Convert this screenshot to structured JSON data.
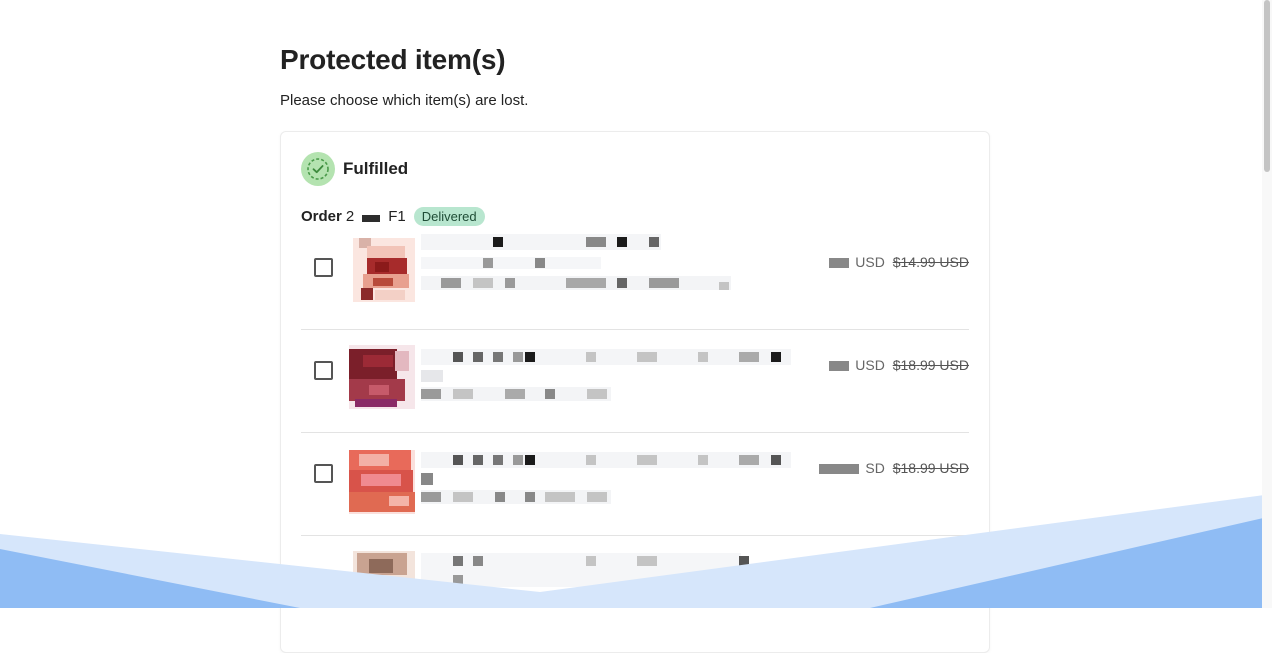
{
  "header": {
    "title": "Protected item(s)",
    "subtitle": "Please choose which item(s) are lost."
  },
  "fulfillment": {
    "status_label": "Fulfilled",
    "status_icon": "check-circle-icon",
    "order_label": "Order",
    "order_number_prefix": "2",
    "order_number_suffix": "F1",
    "badge": "Delivered"
  },
  "items": [
    {
      "currency": "USD",
      "compare_at_price": "$14.99 USD"
    },
    {
      "currency": "USD",
      "compare_at_price": "$18.99 USD"
    },
    {
      "currency": "SD",
      "compare_at_price": "$18.99 USD"
    },
    {
      "currency": "",
      "compare_at_price": ""
    }
  ],
  "colors": {
    "badge_bg": "#b8e6cf",
    "status_icon_bg": "#b4e3b0",
    "wave_light": "#d6e6fb",
    "wave_dark": "#8fbcf4"
  }
}
